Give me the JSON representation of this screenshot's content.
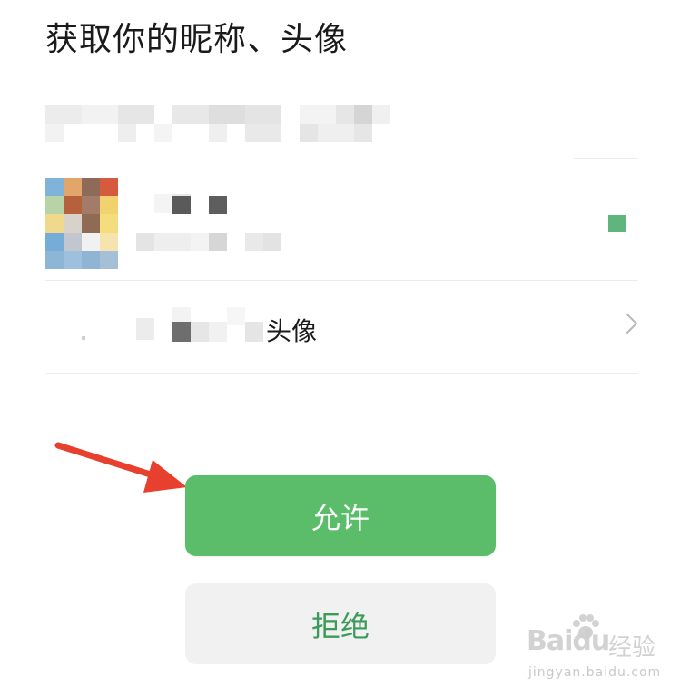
{
  "title": "获取你的昵称、头像",
  "account": {
    "selected_indicator_color": "#5fb57b",
    "avatar_icon": "pixelated-avatar"
  },
  "other_option": {
    "label_visible": "头像",
    "chevron_icon": "chevron-right-icon"
  },
  "buttons": {
    "allow_label": "允许",
    "deny_label": "拒绝"
  },
  "colors": {
    "allow_bg": "#5bbd6a",
    "deny_bg": "#f1f1f1",
    "deny_text": "#3c9a5a",
    "arrow": "#e8402f"
  },
  "watermark": {
    "logo": "Baidu",
    "cn": "经验",
    "url": "jingyan.baidu.com"
  }
}
